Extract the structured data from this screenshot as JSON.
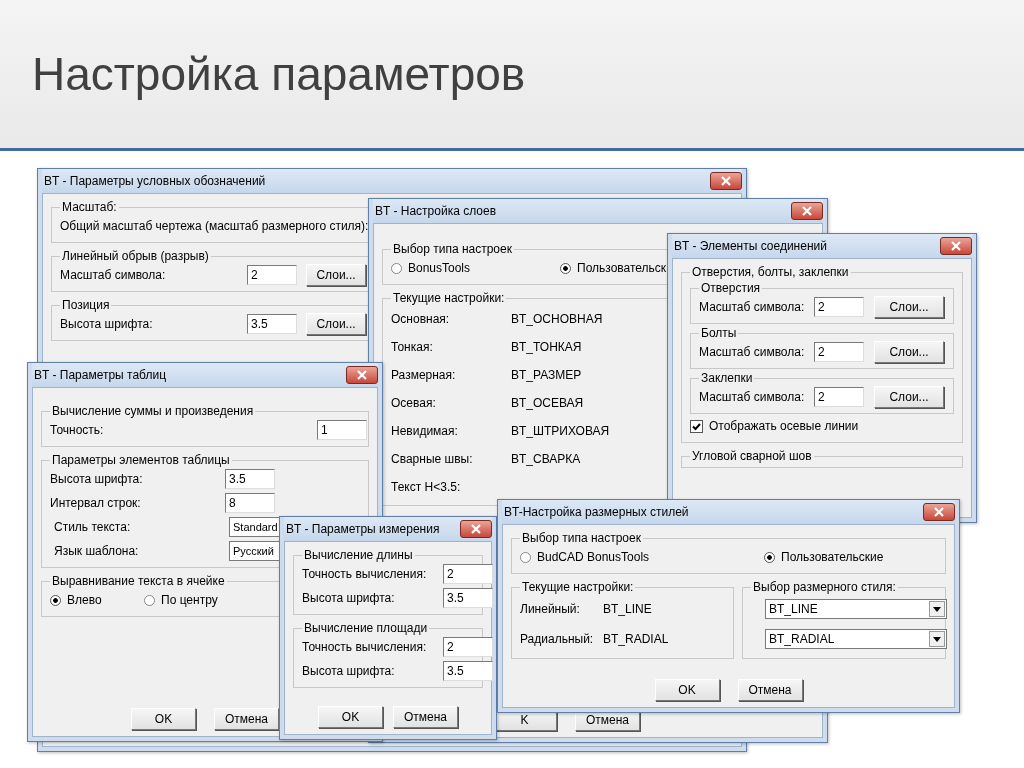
{
  "slide_title": "Настройка параметров",
  "windows": [
    {
      "title": "BT - Параметры условных обозначений",
      "items": [
        {
          "kind": "group",
          "title": "Масштаб:",
          "items": [
            {
              "kind": "text",
              "text": "Общий масштаб чертежа  (масштаб размерного стиля):"
            }
          ]
        },
        {
          "kind": "group",
          "title": "Линейный обрыв (разрыв)",
          "items": [
            {
              "kind": "field",
              "label": "Масштаб символа:",
              "value": "2",
              "button": "Слои..."
            }
          ]
        },
        {
          "kind": "group",
          "title": "Позиция",
          "items": [
            {
              "kind": "field",
              "label": "Высота шрифта:",
              "value": "3.5",
              "button": "Слои..."
            }
          ]
        }
      ]
    },
    {
      "title": "BT - Настройка слоев",
      "items": [
        {
          "kind": "group",
          "title": "Выбор типа настроек",
          "items": [
            {
              "kind": "radios",
              "options": [
                {
                  "label": "BonusTools",
                  "selected": false
                },
                {
                  "label": "Пользовательск",
                  "selected": true
                }
              ]
            }
          ]
        },
        {
          "kind": "group",
          "title": "Текущие настройки:",
          "items": [
            {
              "kind": "pair",
              "label": "Основная:",
              "value": "BT_ОСНОВНАЯ"
            },
            {
              "kind": "pair",
              "label": "Тонкая:",
              "value": "BT_ТОНКАЯ"
            },
            {
              "kind": "pair",
              "label": "Размерная:",
              "value": "BT_РАЗМЕР"
            },
            {
              "kind": "pair",
              "label": "Осевая:",
              "value": "BT_ОСЕВАЯ"
            },
            {
              "kind": "pair",
              "label": "Невидимая:",
              "value": "BT_ШТРИХОВАЯ"
            },
            {
              "kind": "pair",
              "label": "Сварные швы:",
              "value": "BT_СВАРКА"
            },
            {
              "kind": "pair",
              "label": "Текст H<3.5:"
            }
          ]
        },
        {
          "kind": "buttons",
          "buttons": [
            "K",
            "Отмена"
          ]
        }
      ]
    },
    {
      "title": "BT - Элементы соединений",
      "items": [
        {
          "kind": "group",
          "title": "Отверстия, болты, заклепки",
          "items": [
            {
              "kind": "group",
              "title": "Отверстия",
              "items": [
                {
                  "kind": "field",
                  "label": "Масштаб символа:",
                  "value": "2",
                  "button": "Слои..."
                }
              ]
            },
            {
              "kind": "group",
              "title": "Болты",
              "items": [
                {
                  "kind": "field",
                  "label": "Масштаб символа:",
                  "value": "2",
                  "button": "Слои..."
                }
              ]
            },
            {
              "kind": "group",
              "title": "Заклепки",
              "items": [
                {
                  "kind": "field",
                  "label": "Масштаб символа:",
                  "value": "2",
                  "button": "Слои..."
                }
              ]
            },
            {
              "kind": "checkbox",
              "label": "Отображать осевые линии",
              "checked": true
            }
          ]
        },
        {
          "kind": "group",
          "title": "Угловой сварной шов"
        }
      ]
    },
    {
      "title": "BT - Параметры таблиц",
      "items": [
        {
          "kind": "group",
          "title": "Вычисление суммы и произведения",
          "items": [
            {
              "kind": "field",
              "label": "Точность:",
              "value": "1"
            }
          ]
        },
        {
          "kind": "group",
          "title": "Параметры элементов таблицы",
          "items": [
            {
              "kind": "field",
              "label": "Высота шрифта:",
              "value": "3.5"
            },
            {
              "kind": "field",
              "label": "Интервал строк:",
              "value": "8"
            },
            {
              "kind": "select",
              "label": "Стиль текста:",
              "value": "Standard"
            },
            {
              "kind": "select",
              "label": "Язык шаблона:",
              "value": "Русский"
            }
          ]
        },
        {
          "kind": "group",
          "title": "Выравнивание текста в ячейке",
          "items": [
            {
              "kind": "radios",
              "options": [
                {
                  "label": "Влево",
                  "selected": true
                },
                {
                  "label": "По центру",
                  "selected": false
                }
              ]
            }
          ]
        },
        {
          "kind": "buttons",
          "buttons": [
            "OK",
            "Отмена"
          ]
        }
      ]
    },
    {
      "title": "BT - Параметры измерения",
      "items": [
        {
          "kind": "group",
          "title": "Вычисление длины",
          "items": [
            {
              "kind": "field",
              "label": "Точность вычисления:",
              "value": "2"
            },
            {
              "kind": "field",
              "label": "Высота шрифта:",
              "value": "3.5"
            }
          ]
        },
        {
          "kind": "group",
          "title": "Вычисление площади",
          "items": [
            {
              "kind": "field",
              "label": "Точность вычисления:",
              "value": "2"
            },
            {
              "kind": "field",
              "label": "Высота шрифта:",
              "value": "3.5"
            }
          ]
        },
        {
          "kind": "buttons",
          "buttons": [
            "OK",
            "Отмена"
          ]
        }
      ]
    },
    {
      "title": "BT-Настройка размерных стилей",
      "items": [
        {
          "kind": "group",
          "title": "Выбор типа настроек",
          "items": [
            {
              "kind": "radios",
              "options": [
                {
                  "label": "BudCAD BonusTools",
                  "selected": false
                },
                {
                  "label": "Пользовательские",
                  "selected": true
                }
              ]
            }
          ]
        },
        {
          "kind": "columns",
          "items": [
            {
              "kind": "group",
              "title": "Текущие настройки:",
              "items": [
                {
                  "kind": "pair",
                  "label": "Линейный:",
                  "value": "BT_LINE"
                },
                {
                  "kind": "pair",
                  "label": "Радиальный:",
                  "value": "BT_RADIAL"
                }
              ]
            },
            {
              "kind": "group",
              "title": "Выбор размерного стиля:",
              "items": [
                {
                  "kind": "select",
                  "value": "BT_LINE"
                },
                {
                  "kind": "select",
                  "value": "BT_RADIAL"
                }
              ]
            }
          ]
        },
        {
          "kind": "buttons",
          "buttons": [
            "OK",
            "Отмена"
          ]
        }
      ]
    }
  ]
}
